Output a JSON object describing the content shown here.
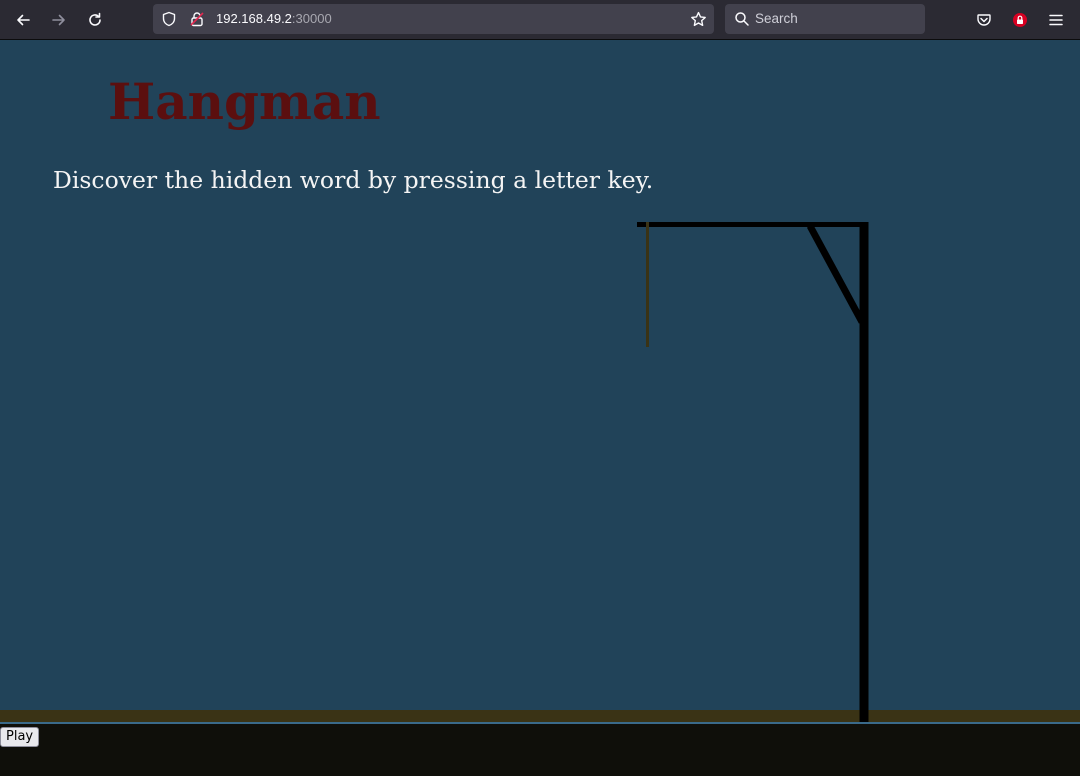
{
  "browser": {
    "url_host": "192.168.49.2",
    "url_port": ":30000",
    "search_placeholder": "Search",
    "icons": [
      "back-arrow-icon",
      "forward-arrow-icon",
      "reload-icon",
      "shield-icon",
      "lock-icon",
      "star-icon",
      "search-icon",
      "pocket-icon",
      "extension-icon",
      "menu-icon"
    ]
  },
  "game": {
    "title": "Hangman",
    "instructions": "Discover the hidden word by pressing a letter key.",
    "play_label": "Play",
    "colors": {
      "background": "#214359",
      "title": "#5b0f0f",
      "text": "#f4f4f4",
      "gallows": "#000000",
      "rope": "#3a3315",
      "ground": "#3a3315",
      "footer": "#0f0f0a"
    }
  }
}
